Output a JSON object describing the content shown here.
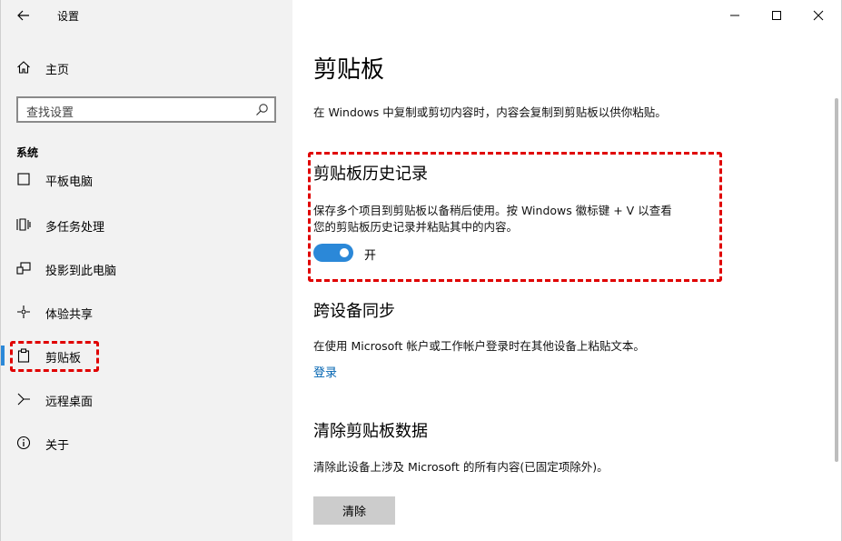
{
  "window": {
    "title": "设置",
    "controls": [
      "minimize",
      "maximize",
      "close"
    ]
  },
  "sidebar": {
    "home_label": "主页",
    "search_placeholder": "查找设置",
    "section_label": "系统",
    "items": [
      {
        "label": "平板电脑",
        "icon": "tablet-icon"
      },
      {
        "label": "多任务处理",
        "icon": "multitask-icon"
      },
      {
        "label": "投影到此电脑",
        "icon": "projection-icon"
      },
      {
        "label": "体验共享",
        "icon": "share-icon"
      },
      {
        "label": "剪贴板",
        "icon": "clipboard-icon",
        "selected": true
      },
      {
        "label": "远程桌面",
        "icon": "remote-desktop-icon"
      },
      {
        "label": "关于",
        "icon": "info-icon"
      }
    ]
  },
  "main": {
    "title": "剪贴板",
    "description": "在 Windows 中复制或剪切内容时，内容会复制到剪贴板以供你粘贴。",
    "history": {
      "heading": "剪贴板历史记录",
      "text_line1": "保存多个项目到剪贴板以备稍后使用。按 Windows 徽标键 + V 以查看",
      "text_line2": "您的剪贴板历史记录并粘贴其中的内容。",
      "toggle_state": "开",
      "toggle_on": true
    },
    "sync": {
      "heading": "跨设备同步",
      "text": "在使用 Microsoft 帐户或工作帐户登录时在其他设备上粘贴文本。",
      "link": "登录"
    },
    "clear": {
      "heading": "清除剪贴板数据",
      "text": "清除此设备上涉及 Microsoft 的所有内容(已固定项除外)。",
      "button": "清除"
    }
  },
  "colors": {
    "accent": "#2b88d8",
    "link": "#0063b1",
    "highlight": "#e00000",
    "sidebar_bg": "#f2f2f2"
  }
}
